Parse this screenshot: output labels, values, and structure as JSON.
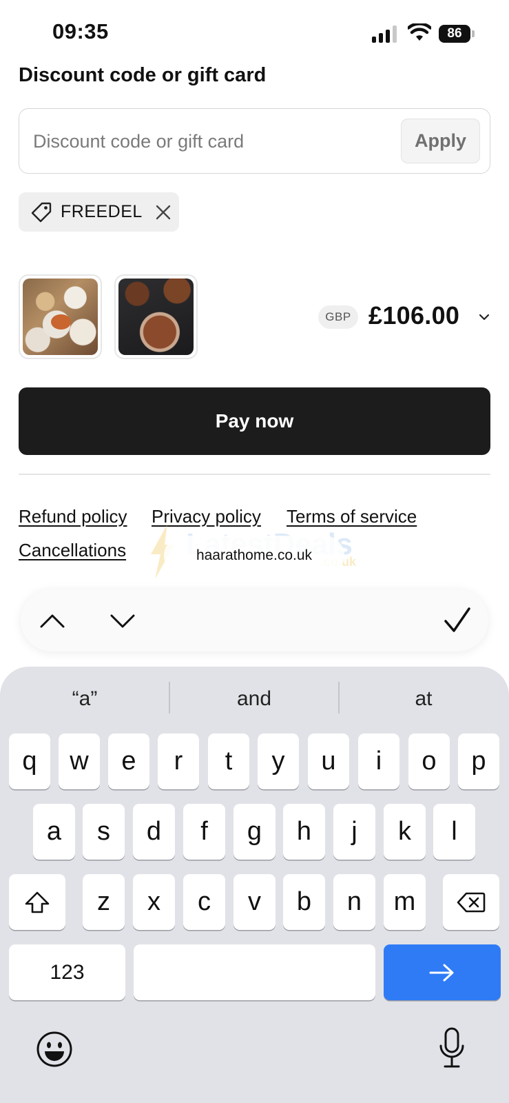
{
  "status_bar": {
    "time": "09:35",
    "battery": "86"
  },
  "discount": {
    "heading": "Discount code or gift card",
    "input_placeholder": "Discount code or gift card",
    "input_value": "",
    "apply_label": "Apply",
    "applied_code": "FREEDEL"
  },
  "order": {
    "currency": "GBP",
    "total": "£106.00"
  },
  "pay_button_label": "Pay now",
  "policies": {
    "refund": "Refund policy",
    "privacy": "Privacy policy",
    "terms": "Terms of service",
    "cancellations": "Cancellations"
  },
  "browser": {
    "domain": "haarathome.co.uk"
  },
  "watermark": {
    "text": "LatestDeals",
    "sub": ".co.uk"
  },
  "keyboard": {
    "suggestions": [
      "“a”",
      "and",
      "at"
    ],
    "row1": [
      "q",
      "w",
      "e",
      "r",
      "t",
      "y",
      "u",
      "i",
      "o",
      "p"
    ],
    "row2": [
      "a",
      "s",
      "d",
      "f",
      "g",
      "h",
      "j",
      "k",
      "l"
    ],
    "row3": [
      "z",
      "x",
      "c",
      "v",
      "b",
      "n",
      "m"
    ],
    "numbers_label": "123",
    "return_color": "#2f7bf6"
  },
  "icons": {
    "signal": "signal-icon",
    "wifi": "wifi-icon",
    "battery": "battery-icon",
    "tag": "tag-icon",
    "remove": "close-icon",
    "chevron": "chevron-down-icon",
    "up": "chevron-up-icon",
    "down": "chevron-down-icon",
    "done": "checkmark-icon",
    "shift": "shift-icon",
    "backspace": "backspace-icon",
    "return": "arrow-right-icon",
    "emoji": "emoji-icon",
    "mic": "microphone-icon"
  }
}
